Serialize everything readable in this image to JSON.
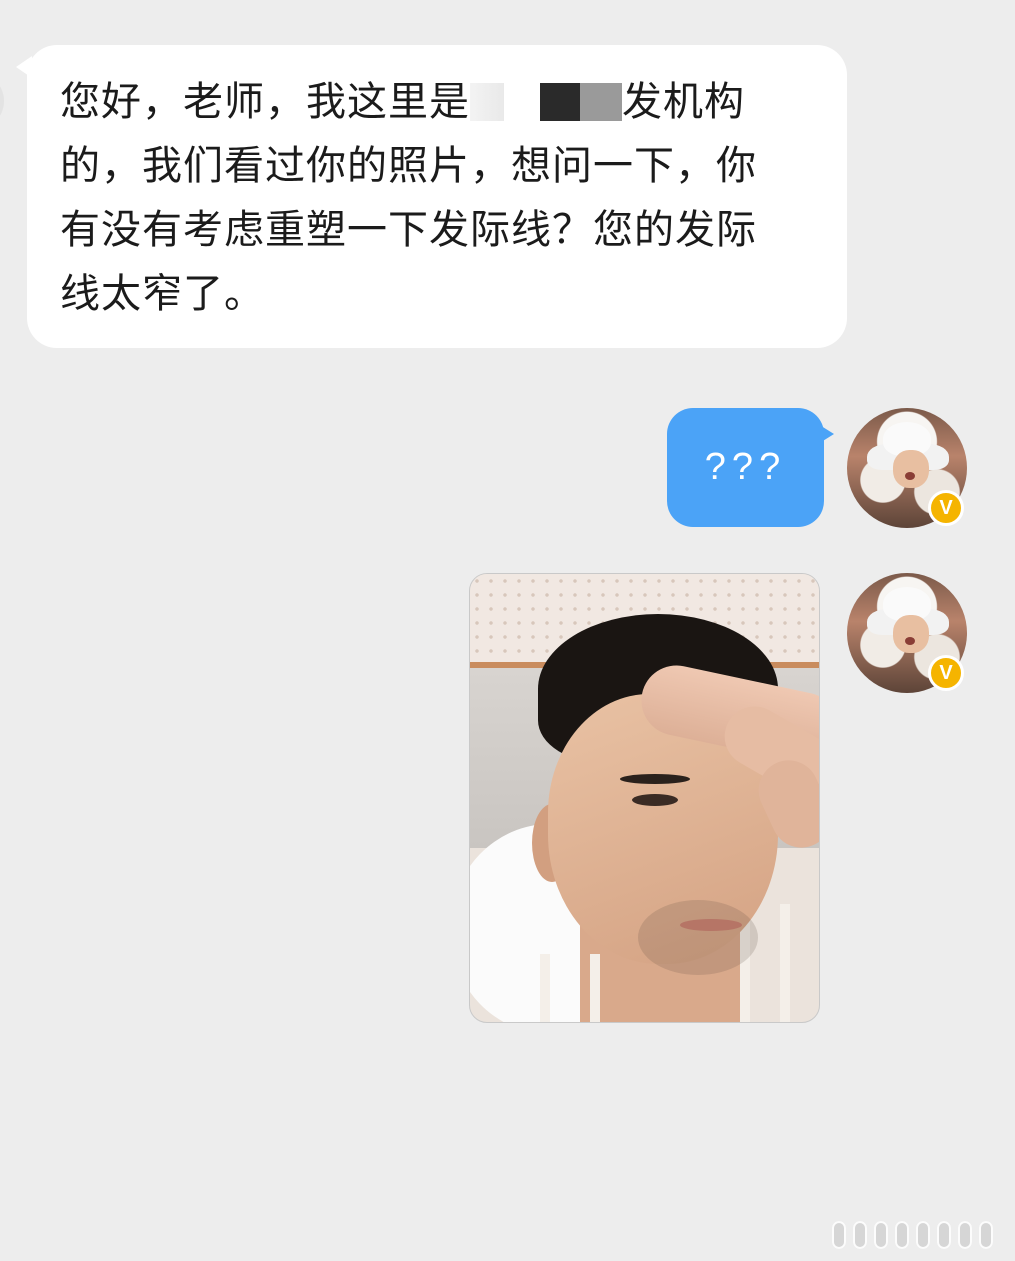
{
  "messages": [
    {
      "side": "incoming",
      "type": "text",
      "text_before": "您好，老师，我这里是",
      "text_after": "发机构的，我们看过你的照片，想问一下，你有没有考虑重塑一下发际线？您的发际线太窄了。"
    },
    {
      "side": "outgoing",
      "type": "text",
      "text": "???",
      "bubble_color": "#4ba3f7",
      "verified_badge": "V"
    },
    {
      "side": "outgoing",
      "type": "image",
      "verified_badge": "V"
    }
  ],
  "colors": {
    "background": "#ededed",
    "incoming_bubble": "#ffffff",
    "outgoing_bubble": "#4ba3f7",
    "verified_badge": "#f5b400"
  }
}
